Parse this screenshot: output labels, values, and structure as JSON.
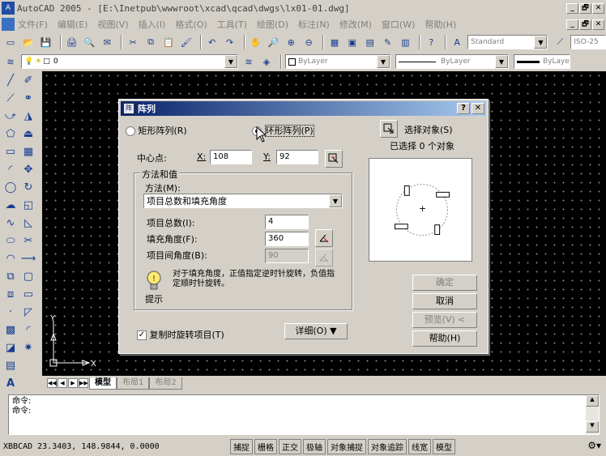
{
  "window": {
    "icon_text": "A",
    "title": "AutoCAD 2005 - [E:\\Inetpub\\wwwroot\\xcad\\qcad\\dwgs\\lx01-01.dwg]",
    "min": "_",
    "restore": "🗗",
    "close": "✕",
    "inner_min": "_",
    "inner_restore": "🗗",
    "inner_close": "✕"
  },
  "menu": [
    "文件(F)",
    "编辑(E)",
    "视图(V)",
    "插入(I)",
    "格式(O)",
    "工具(T)",
    "绘图(D)",
    "标注(N)",
    "修改(M)",
    "窗口(W)",
    "帮助(H)"
  ],
  "toolbar": {
    "text_style": "Standard",
    "dim_style": "ISO-25",
    "layer_value": "0",
    "color_value": "ByLayer",
    "linetype_value": "ByLayer",
    "lineweight_value": "ByLaye"
  },
  "tabs": [
    "模型",
    "布局1",
    "布局2"
  ],
  "tab_nav": [
    "◀◀",
    "◀",
    "▶",
    "▶▶"
  ],
  "ucs": {
    "x": "X",
    "y": "Y"
  },
  "command": {
    "lines": [
      "命令:",
      "命令:"
    ]
  },
  "statusbar": {
    "coords": "XBBCAD 23.3403,  148.9844, 0.0000",
    "buttons": [
      "捕捉",
      "栅格",
      "正交",
      "极轴",
      "对象捕捉",
      "对象追踪",
      "线宽",
      "模型"
    ]
  },
  "dialog": {
    "icon_text": "阵",
    "title": "阵列",
    "help": "?",
    "close": "✕",
    "rect_array": "矩形阵列(R)",
    "polar_array": "环形阵列(P)",
    "select_objects": "选择对象(S)",
    "selected_count": "已选择 0 个对象",
    "center_label": "中心点:",
    "x_label": "X:",
    "x_value": "108",
    "y_label": "Y:",
    "y_value": "92",
    "method_group": "方法和值",
    "method_label": "方法(M):",
    "method_value": "项目总数和填充角度",
    "total_items_label": "项目总数(I):",
    "total_items_value": "4",
    "fill_angle_label": "填充角度(F):",
    "fill_angle_value": "360",
    "item_angle_label": "项目间角度(B):",
    "item_angle_value": "90",
    "tip_text": "对于填充角度，正值指定逆时针旋转，负值指定顺时针旋转。",
    "tip_label": "提示",
    "rotate_items": "复制时旋转项目(T)",
    "details_button": "详细(O) ▼",
    "ok": "确定",
    "cancel": "取消",
    "preview": "预览(V) <",
    "help_button": "帮助(H)",
    "preview_center": "+"
  }
}
